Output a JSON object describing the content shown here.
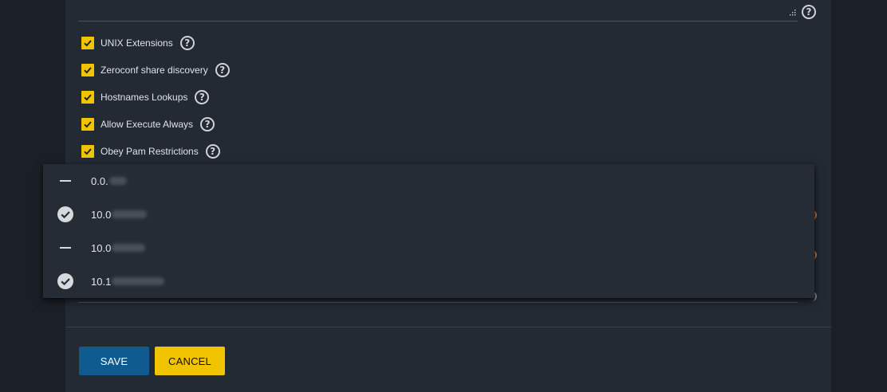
{
  "form": {
    "checkboxes": [
      {
        "label": "UNIX Extensions",
        "checked": true
      },
      {
        "label": "Zeroconf share discovery",
        "checked": true
      },
      {
        "label": "Hostnames Lookups",
        "checked": true
      },
      {
        "label": "Allow Execute Always",
        "checked": true
      },
      {
        "label": "Obey Pam Restrictions",
        "checked": true
      }
    ],
    "help_glyph": "?"
  },
  "dropdown": {
    "options": [
      {
        "text": "0.0.",
        "selected": false,
        "icon": "minus-icon"
      },
      {
        "text": "10.0",
        "selected": true,
        "icon": "check-circle-icon"
      },
      {
        "text": "10.0",
        "selected": false,
        "icon": "minus-icon"
      },
      {
        "text": "10.1",
        "selected": true,
        "icon": "check-circle-icon"
      }
    ]
  },
  "actions": {
    "save_label": "SAVE",
    "cancel_label": "CANCEL"
  },
  "colors": {
    "accent": "#f0c400",
    "primary": "#0f5a8e",
    "panel": "#232a33",
    "background": "#1b2026"
  }
}
